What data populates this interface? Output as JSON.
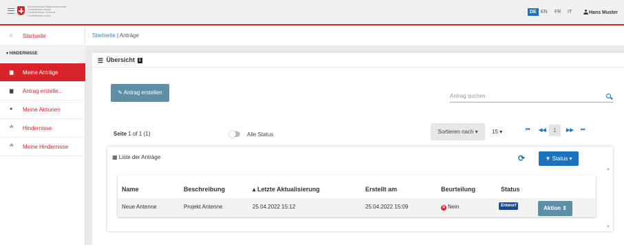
{
  "header": {
    "confederation_lines": [
      "Schweizerische Eidgenossenschaft",
      "Confédération suisse",
      "Confederazione Svizzera",
      "Confederaziun svizra"
    ],
    "languages": [
      "DE",
      "EN",
      "FR",
      "IT"
    ],
    "active_language": "DE",
    "user_name": "Hans Muster"
  },
  "sidebar": {
    "home": "Startseite",
    "section": "▾ HINDERNISSE",
    "items": [
      {
        "label": "Meine Anträge",
        "active": true
      },
      {
        "label": "Antrag erstelle..."
      },
      {
        "label": "Meine Aktionen"
      },
      {
        "label": "Hindernisse"
      },
      {
        "label": "Meine Hindernisse"
      }
    ]
  },
  "breadcrumb": {
    "home": "Startseite",
    "separator": "|",
    "current": "Anträge"
  },
  "overview": {
    "title": "Übersicht",
    "count": "1"
  },
  "toolbar": {
    "create_label": "Antrag erstellen",
    "search_placeholder": "Antrag suchen",
    "page_info_prefix": "Seite",
    "page_info_value": "1 of 1 (1)",
    "toggle_label": "Alle Status",
    "sort_label": "Sortieren nach ▾",
    "per_page": "15 ▾",
    "current_page": "1"
  },
  "list": {
    "title": "Liste der Anträge",
    "status_filter": "Status ▾",
    "columns": [
      "Name",
      "Beschreibung",
      "▴ Letzte Aktualisierung",
      "Erstellt am",
      "Beurteilung",
      "Status"
    ],
    "rows": [
      {
        "name": "Neue Antenne",
        "description": "Projekt Antenne",
        "updated": "25.04.2022 15:12",
        "created": "25.04.2022 15:09",
        "assessment": "Nein",
        "status": "Entwurf",
        "action": "Aktion ⇕"
      }
    ]
  },
  "colors": {
    "accent_red": "#d8232a",
    "primary_blue": "#1d72c0",
    "button_teal": "#5e8fa8"
  }
}
